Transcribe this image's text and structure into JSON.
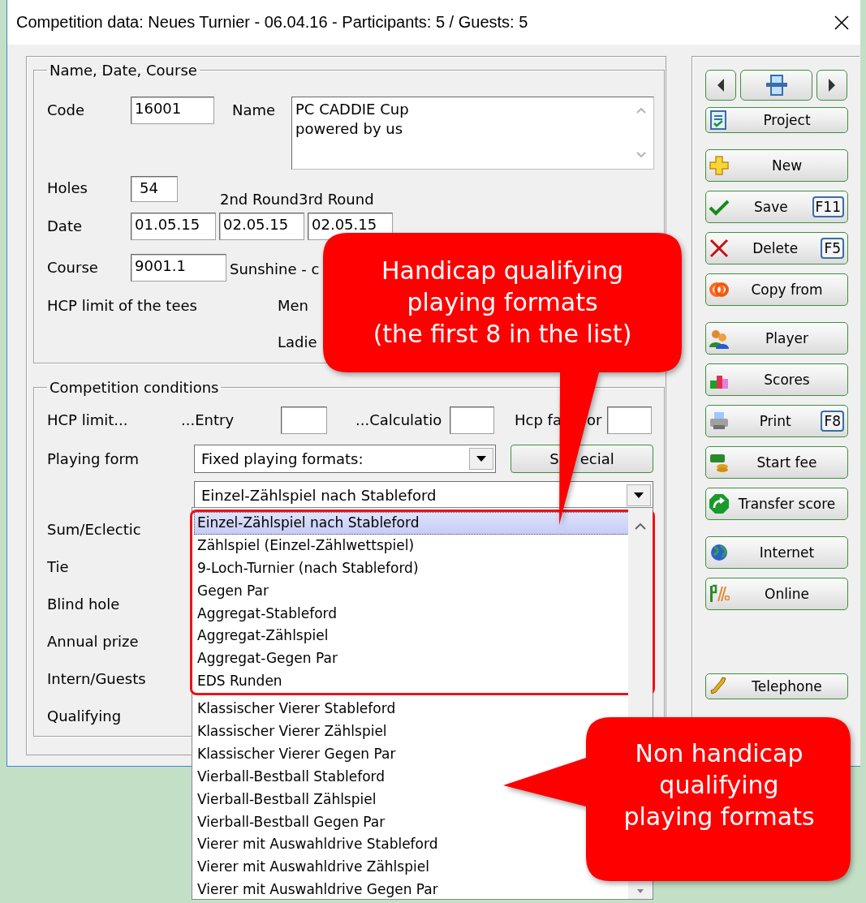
{
  "window": {
    "title": "Competition data: Neues Turnier - 06.04.16 - Participants: 5 / Guests: 5"
  },
  "name_date_course": {
    "legend": "Name, Date, Course",
    "code_label": "Code",
    "code": "16001",
    "name_label": "Name",
    "name": "PC CADDIE Cup\npowered by us",
    "holes_label": "Holes",
    "holes": "54",
    "round_labels": [
      "2nd Round",
      "3rd Round"
    ],
    "date_label": "Date",
    "dates": [
      "01.05.15",
      "02.05.15",
      "02.05.15"
    ],
    "course_label": "Course",
    "course": "9001.1",
    "course_name": "Sunshine - c",
    "hcp_tees_label": "HCP limit of the tees",
    "men_label": "Men",
    "ladies_label": "Ladie"
  },
  "conditions": {
    "legend": "Competition conditions",
    "hcp_limit_label": "HCP limit...",
    "entry_label": "...Entry",
    "calculation_label": "...Calculatio",
    "hcp_factor_label": [
      "Hcp fa",
      "or"
    ],
    "playing_form_label": "Playing form",
    "playing_form": "Fixed playing formats:",
    "special_button": [
      "S",
      "ecial"
    ],
    "format": "Einzel-Zählspiel nach Stableford",
    "labels": [
      "Sum/Eclectic",
      "Tie",
      "Blind hole",
      "Annual prize",
      "Intern/Guests",
      "Qualifying"
    ]
  },
  "format_list": {
    "sections": [
      {
        "outlined": true,
        "items": [
          {
            "label": "Einzel-Zählspiel nach Stableford",
            "selected": true
          },
          {
            "label": "Zählspiel (Einzel-Zählwettspiel)",
            "selected": false
          },
          {
            "label": "9-Loch-Turnier (nach Stableford)",
            "selected": false
          },
          {
            "label": "Gegen Par",
            "selected": false
          },
          {
            "label": "Aggregat-Stableford",
            "selected": false
          },
          {
            "label": "Aggregat-Zählspiel",
            "selected": false
          },
          {
            "label": "Aggregat-Gegen Par",
            "selected": false
          },
          {
            "label": "EDS Runden",
            "selected": false
          }
        ]
      },
      {
        "outlined": false,
        "items": [
          {
            "label": "Klassischer Vierer Stableford",
            "selected": false
          },
          {
            "label": "Klassischer Vierer Zählspiel",
            "selected": false
          },
          {
            "label": "Klassischer Vierer Gegen Par",
            "selected": false
          },
          {
            "label": "Vierball-Bestball Stableford",
            "selected": false
          },
          {
            "label": "Vierball-Bestball Zählspiel",
            "selected": false
          },
          {
            "label": "Vierball-Bestball Gegen Par",
            "selected": false
          },
          {
            "label": "Vierer mit Auswahldrive Stableford",
            "selected": false
          },
          {
            "label": "Vierer mit Auswahldrive Zählspiel",
            "selected": false
          },
          {
            "label": "Vierer mit Auswahldrive Gegen Par",
            "selected": false
          }
        ]
      }
    ]
  },
  "sidebar": {
    "groups": [
      [
        {
          "label": "Project"
        }
      ],
      [
        {
          "label": "New"
        },
        {
          "label": "Save",
          "shortcut": "F11"
        },
        {
          "label": "Delete",
          "shortcut": "F5"
        },
        {
          "label": "Copy from"
        }
      ],
      [
        {
          "label": "Player"
        },
        {
          "label": "Scores"
        },
        {
          "label": "Print",
          "shortcut": "F8"
        },
        {
          "label": "Start fee"
        },
        {
          "label": "Transfer score"
        }
      ],
      [
        {
          "label": "Internet"
        },
        {
          "label": "Online"
        }
      ],
      [
        {
          "label": "Telephone"
        }
      ]
    ]
  },
  "callouts": [
    {
      "text": "Handicap qualifying\nplaying formats\n(the first 8 in the list)"
    },
    {
      "text": "Non handicap\nqualifying\nplaying formats"
    }
  ]
}
